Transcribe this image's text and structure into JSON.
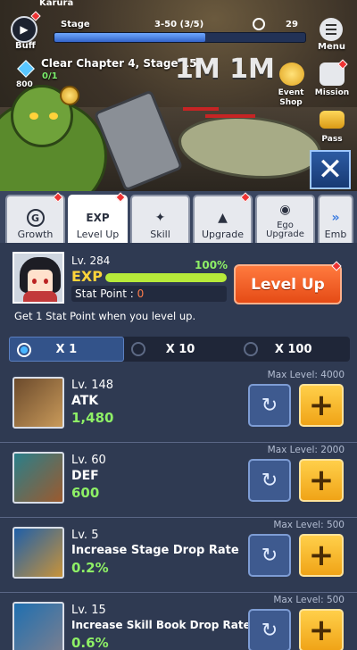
{
  "hud": {
    "player_name": "Karura",
    "buff_label": "Buff",
    "stage_label": "Stage",
    "stage_value": "3-50 (3/5)",
    "stage_progress_pct": 60,
    "timer_value": "29",
    "menu_label": "Menu",
    "gems": "800",
    "quest_text": "Clear Chapter 4, Stage 15",
    "quest_progress": "0/1",
    "damage_text": "1M  1M",
    "event_shop_label": "Event Shop",
    "mission_label": "Mission",
    "pass_label": "Pass",
    "close_icon": "close-x-icon"
  },
  "tabs": [
    {
      "label": "Growth",
      "icon": "G"
    },
    {
      "label": "Level Up",
      "icon": "EXP"
    },
    {
      "label": "Skill",
      "icon": "✦"
    },
    {
      "label": "Upgrade",
      "icon": "▲"
    },
    {
      "label": "Ego Upgrade",
      "icon": "◉"
    },
    {
      "label": "Emb",
      "icon": "»"
    }
  ],
  "hero": {
    "level": "Lv. 284",
    "exp_label": "EXP",
    "exp_percent": "100%",
    "exp_fill": 100,
    "stat_point_label": "Stat Point : ",
    "stat_point_value": "0",
    "level_up_button": "Level Up",
    "hint": "Get 1 Stat Point when you level up."
  },
  "multipliers": [
    "X 1",
    "X 10",
    "X 100"
  ],
  "stats": [
    {
      "level": "Lv. 148",
      "name": "ATK",
      "value": "1,480",
      "max": "Max Level: 4000"
    },
    {
      "level": "Lv. 60",
      "name": "DEF",
      "value": "600",
      "max": "Max Level: 2000"
    },
    {
      "level": "Lv. 5",
      "name": "Increase Stage Drop Rate",
      "value": "0.2%",
      "max": "Max Level: 500"
    },
    {
      "level": "Lv. 15",
      "name": "Increase Skill Book Drop Rate",
      "value": "0.6%",
      "max": "Max Level: 500"
    }
  ],
  "icons": {
    "reset": "↻",
    "plus": "+",
    "close": "✕"
  }
}
